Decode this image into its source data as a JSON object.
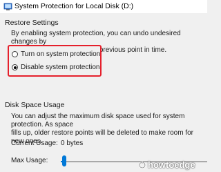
{
  "window": {
    "title": "System Protection for Local Disk (D:)",
    "icon": "system-protection-icon"
  },
  "restore": {
    "heading": "Restore Settings",
    "description_line1": "By enabling system protection, you can undo undesired changes by",
    "description_line2": "reverting your computer to a previous point in time.",
    "options": [
      {
        "label": "Turn on system protection",
        "checked": false
      },
      {
        "label": "Disable system protection",
        "checked": true
      }
    ],
    "highlight_color": "#e5202c"
  },
  "disk": {
    "heading": "Disk Space Usage",
    "description_line1": "You can adjust the maximum disk space used for system protection. As space",
    "description_line2": "fills up, older restore points will be deleted to make room for new ones.",
    "current_usage_label": "Current Usage:",
    "current_usage_value": "0 bytes",
    "max_usage_label": "Max Usage:",
    "max_usage_fraction": 0.01,
    "slider_color": "#0078d7"
  },
  "watermark": {
    "text": "howtoedge",
    "icon": "gear-wrench-icon"
  }
}
